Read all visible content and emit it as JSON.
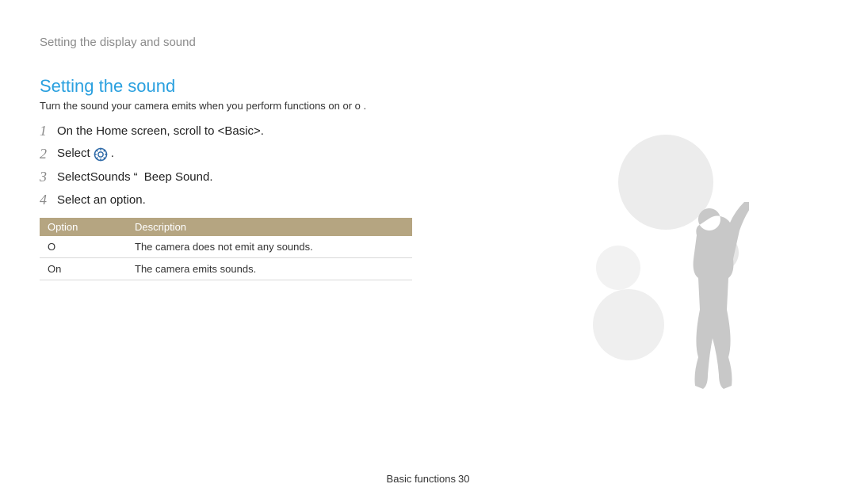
{
  "breadcrumb": "Setting the display and sound",
  "section": {
    "title": "Setting the sound",
    "description": "Turn the sound your camera emits when you perform functions on or o ."
  },
  "steps": [
    {
      "num": "1",
      "text": "On the Home screen, scroll to <Basic>."
    },
    {
      "num": "2",
      "prefix": "Select",
      "suffix": "."
    },
    {
      "num": "3",
      "prefix": "Select",
      "mid_a": "Sounds",
      "mid_b": "Beep Sound",
      "suffix": "."
    },
    {
      "num": "4",
      "text": "Select an option."
    }
  ],
  "table": {
    "headers": {
      "option": "Option",
      "description": "Description"
    },
    "rows": [
      {
        "option": "O",
        "description": "The camera does not emit any sounds."
      },
      {
        "option": "On",
        "description": "The camera emits sounds."
      }
    ]
  },
  "footer": {
    "label": "Basic functions",
    "page": "30"
  },
  "glyphs": {
    "arrow": "“"
  }
}
